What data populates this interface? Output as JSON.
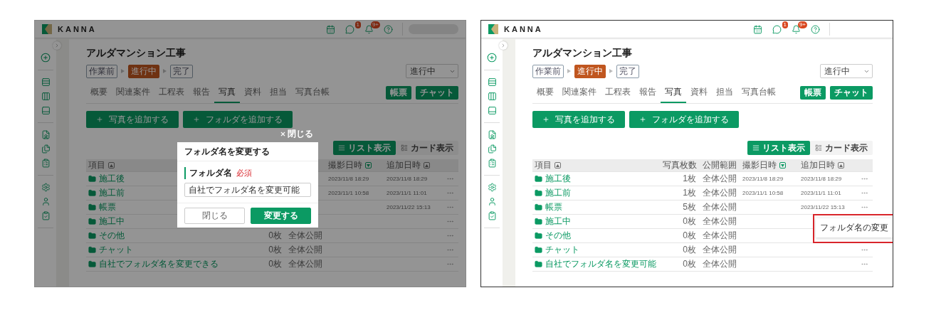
{
  "panels": [
    {
      "dimmed": true,
      "user_blurred": true,
      "header": {
        "logo": "KANNA",
        "chat_badge": "1",
        "bell_badge": "9+"
      },
      "project": {
        "title": "アルダマンション工事",
        "steps": [
          {
            "label": "作業前",
            "selected": false
          },
          {
            "label": "進行中",
            "selected": true
          },
          {
            "label": "完了",
            "selected": false
          }
        ],
        "status_select": "進行中"
      },
      "tabs": [
        {
          "label": "概要",
          "selected": false
        },
        {
          "label": "関連案件",
          "selected": false
        },
        {
          "label": "工程表",
          "selected": false
        },
        {
          "label": "報告",
          "selected": false
        },
        {
          "label": "写真",
          "selected": true
        },
        {
          "label": "資料",
          "selected": false
        },
        {
          "label": "担当",
          "selected": false
        },
        {
          "label": "写真台帳",
          "selected": false
        }
      ],
      "tab_buttons": [
        "帳票",
        "チャット"
      ],
      "add_buttons": [
        "写真を追加する",
        "フォルダを追加する"
      ],
      "view_toggle": [
        {
          "label": "リスト表示",
          "selected": true
        },
        {
          "label": "カード表示",
          "selected": false
        }
      ],
      "table": {
        "header": {
          "item": {
            "label": "項目",
            "descending": false,
            "active": false
          },
          "shot_at": {
            "label": "撮影日時",
            "descending": true,
            "active": true
          },
          "added_at": {
            "label": "追加日時",
            "descending": false,
            "active": false
          }
        },
        "rows": [
          {
            "name": "施工後",
            "shot_at": "2023/11/8 18:29",
            "added_at": "2023/11/8 18:29",
            "more": true
          },
          {
            "name": "施工前",
            "shot_at": "2023/11/1 10:58",
            "added_at": "2023/11/1 11:01",
            "more": true
          },
          {
            "name": "帳票",
            "added_at": "2023/11/22 15:13",
            "more": true
          },
          {
            "name": "施工中",
            "more": true
          },
          {
            "name": "その他",
            "photo_count": "0枚",
            "visibility": "全体公開",
            "more": true
          },
          {
            "name": "チャット",
            "photo_count": "0枚",
            "visibility": "全体公開",
            "more": true
          },
          {
            "name": "自社でフォルダ名を変更できる",
            "photo_count": "0枚",
            "visibility": "全体公開",
            "more": true
          }
        ]
      },
      "modal": {
        "close": "閉じる",
        "title": "フォルダ名を変更する",
        "field_label": "フォルダ名",
        "required": "必須",
        "value": "自社でフォルダ名を変更可能",
        "buttons": [
          {
            "label": "閉じる",
            "kind": "secondary"
          },
          {
            "label": "変更する",
            "kind": "primary"
          }
        ]
      }
    },
    {
      "dimmed": false,
      "user_blurred": false,
      "header": {
        "logo": "KANNA",
        "chat_badge": "1",
        "bell_badge": "9+"
      },
      "project": {
        "title": "アルダマンション工事",
        "steps": [
          {
            "label": "作業前",
            "selected": false
          },
          {
            "label": "進行中",
            "selected": true
          },
          {
            "label": "完了",
            "selected": false
          }
        ],
        "status_select": "進行中"
      },
      "tabs": [
        {
          "label": "概要",
          "selected": false
        },
        {
          "label": "関連案件",
          "selected": false
        },
        {
          "label": "工程表",
          "selected": false
        },
        {
          "label": "報告",
          "selected": false
        },
        {
          "label": "写真",
          "selected": true
        },
        {
          "label": "資料",
          "selected": false
        },
        {
          "label": "担当",
          "selected": false
        },
        {
          "label": "写真台帳",
          "selected": false
        }
      ],
      "tab_buttons": [
        "帳票",
        "チャット"
      ],
      "add_buttons": [
        "写真を追加する",
        "フォルダを追加する"
      ],
      "view_toggle": [
        {
          "label": "リスト表示",
          "selected": true
        },
        {
          "label": "カード表示",
          "selected": false
        }
      ],
      "table": {
        "header": {
          "item": {
            "label": "項目",
            "descending": false,
            "active": false
          },
          "photo_count": {
            "label": "写真枚数"
          },
          "visibility": {
            "label": "公開範囲"
          },
          "shot_at": {
            "label": "撮影日時",
            "descending": true,
            "active": true
          },
          "added_at": {
            "label": "追加日時",
            "descending": false,
            "active": false
          }
        },
        "rows": [
          {
            "name": "施工後",
            "photo_count": "1枚",
            "visibility": "全体公開",
            "shot_at": "2023/11/8 18:29",
            "added_at": "2023/11/8 18:29",
            "more": true
          },
          {
            "name": "施工前",
            "photo_count": "1枚",
            "visibility": "全体公開",
            "shot_at": "2023/11/1 10:58",
            "added_at": "2023/11/1 11:01",
            "more": true
          },
          {
            "name": "帳票",
            "photo_count": "5枚",
            "visibility": "全体公開",
            "added_at": "2023/11/22 15:13",
            "more": true,
            "menu": {
              "item": "フォルダ名の変更",
              "highlighted": true
            }
          },
          {
            "name": "施工中",
            "photo_count": "0枚",
            "visibility": "全体公開",
            "more": false
          },
          {
            "name": "その他",
            "photo_count": "0枚",
            "visibility": "全体公開",
            "more": false
          },
          {
            "name": "チャット",
            "photo_count": "0枚",
            "visibility": "全体公開",
            "more": true
          },
          {
            "name": "自社でフォルダ名を変更可能",
            "photo_count": "0枚",
            "visibility": "全体公開",
            "more": true
          }
        ]
      }
    }
  ]
}
